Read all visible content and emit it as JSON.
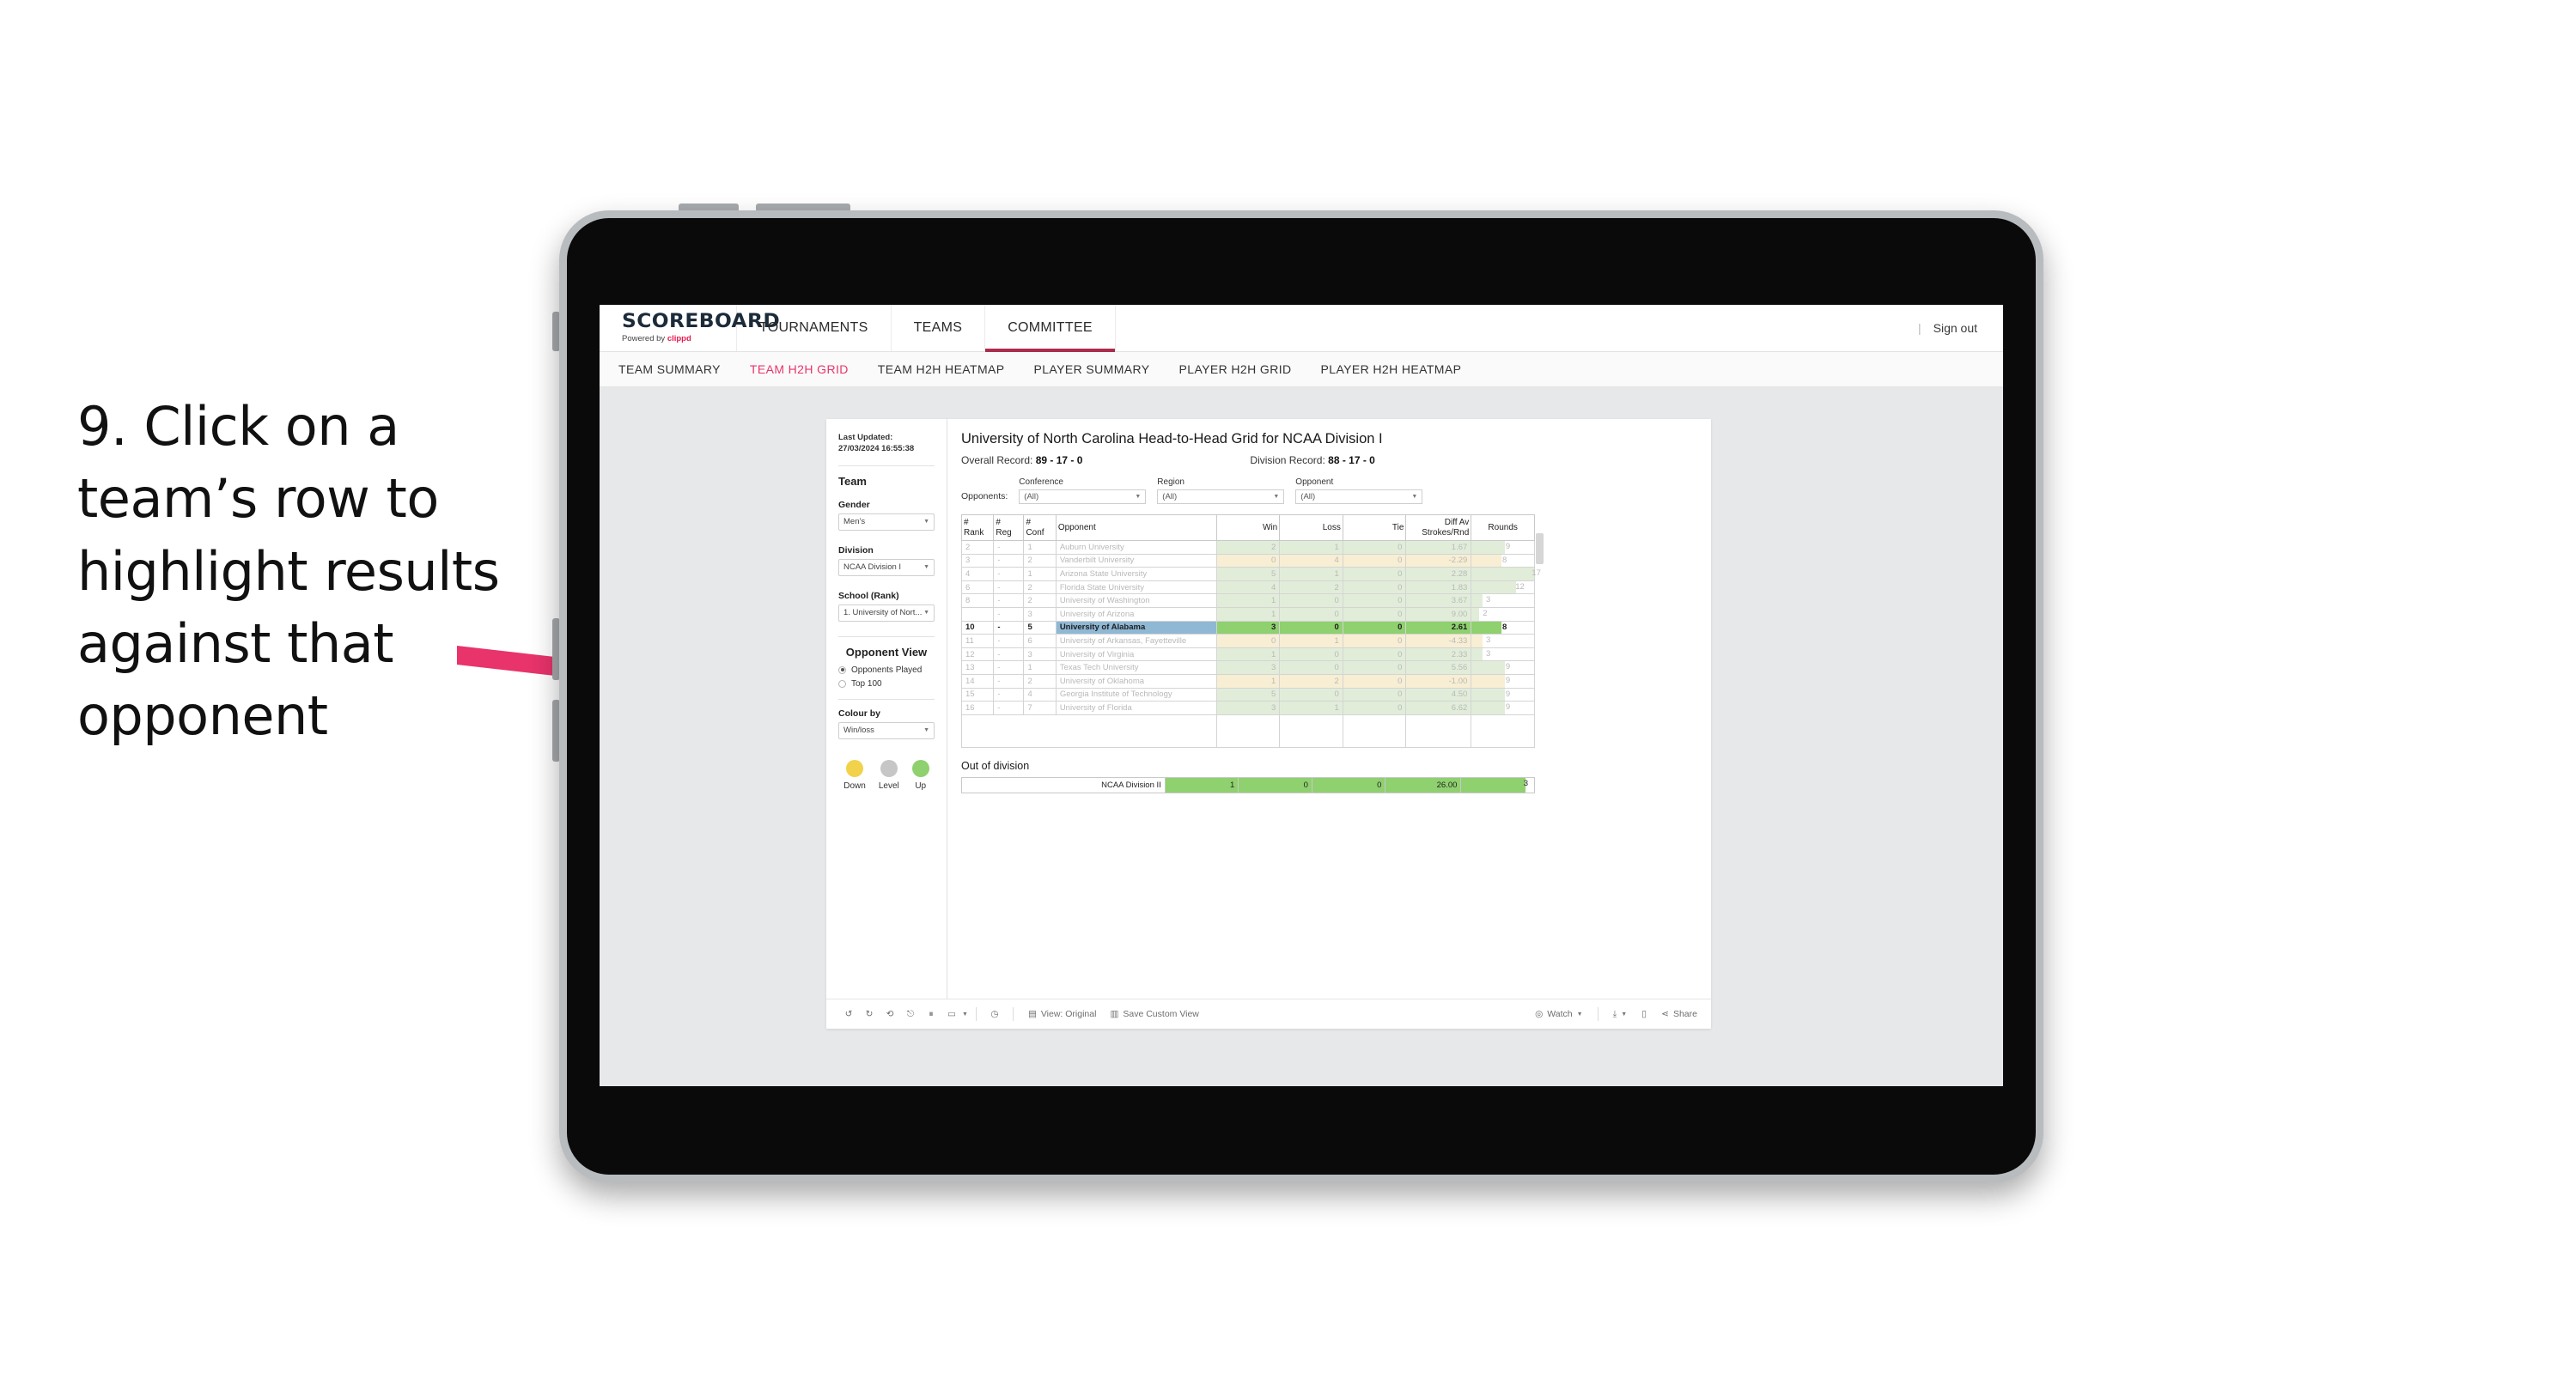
{
  "annotation": {
    "text": "9. Click on a team’s row to highlight results against that opponent",
    "arrow_color": "#E8336B"
  },
  "app": {
    "brand": {
      "title": "SCOREBOARD",
      "powered_prefix": "Powered by ",
      "powered_brand": "clippd"
    },
    "topnav": [
      {
        "label": "TOURNAMENTS",
        "active": false
      },
      {
        "label": "TEAMS",
        "active": false
      },
      {
        "label": "COMMITTEE",
        "active": true
      }
    ],
    "topbar_right": {
      "separator": "|",
      "sign_out": "Sign out"
    },
    "subnav": [
      {
        "label": "TEAM SUMMARY",
        "active": false
      },
      {
        "label": "TEAM H2H GRID",
        "active": true
      },
      {
        "label": "TEAM H2H HEATMAP",
        "active": false
      },
      {
        "label": "PLAYER SUMMARY",
        "active": false
      },
      {
        "label": "PLAYER H2H GRID",
        "active": false
      },
      {
        "label": "PLAYER H2H HEATMAP",
        "active": false
      }
    ],
    "accent_active": "#e8356b",
    "accent_underline": "#ab2c4c"
  },
  "sidebar": {
    "last_updated": "Last Updated: 27/03/2024 16:55:38",
    "team_heading": "Team",
    "fields": [
      {
        "label": "Gender",
        "value": "Men’s"
      },
      {
        "label": "Division",
        "value": "NCAA Division I"
      },
      {
        "label": "School (Rank)",
        "value": "1. University of Nort..."
      }
    ],
    "opponent_view": {
      "heading": "Opponent View",
      "options": [
        {
          "label": "Opponents Played",
          "selected": true
        },
        {
          "label": "Top 100",
          "selected": false
        }
      ]
    },
    "colour_by": {
      "label": "Colour by",
      "value": "Win/loss"
    },
    "legend": [
      {
        "label": "Down",
        "color": "#f2d14b"
      },
      {
        "label": "Level",
        "color": "#c6c6c6"
      },
      {
        "label": "Up",
        "color": "#8fd06f"
      }
    ]
  },
  "report": {
    "title": "University of North Carolina Head-to-Head Grid for NCAA Division I",
    "overall_record_label": "Overall Record:",
    "overall_record_value": "89 - 17 - 0",
    "division_record_label": "Division Record:",
    "division_record_value": "88 - 17 - 0",
    "opponents_prefix": "Opponents:",
    "filters": [
      {
        "label": "Conference",
        "value": "(All)"
      },
      {
        "label": "Region",
        "value": "(All)"
      },
      {
        "label": "Opponent",
        "value": "(All)"
      }
    ],
    "out_of_division_heading": "Out of division",
    "out_of_division_row": {
      "label": "NCAA Division II",
      "win": "1",
      "loss": "0",
      "tie": "0",
      "diff": "26.00",
      "rounds": "3",
      "rounds_pct": 88
    }
  },
  "chart_data": {
    "type": "table",
    "title": "University of North Carolina Head-to-Head Grid for NCAA Division I",
    "columns": [
      "# Rank",
      "# Reg",
      "# Conf",
      "Opponent",
      "Win",
      "Loss",
      "Tie",
      "Diff Av Strokes/Rnd",
      "Rounds"
    ],
    "max_rounds": 17,
    "rows": [
      {
        "rank": "2",
        "reg": "-",
        "conf": "1",
        "opponent": "Auburn University",
        "win": "2",
        "loss": "1",
        "tie": "0",
        "diff": "1.67",
        "rounds": "9",
        "tone": "up",
        "selected": false
      },
      {
        "rank": "3",
        "reg": "-",
        "conf": "2",
        "opponent": "Vanderbilt University",
        "win": "0",
        "loss": "4",
        "tie": "0",
        "diff": "-2.29",
        "rounds": "8",
        "tone": "down",
        "selected": false
      },
      {
        "rank": "4",
        "reg": "-",
        "conf": "1",
        "opponent": "Arizona State University",
        "win": "5",
        "loss": "1",
        "tie": "0",
        "diff": "2.28",
        "rounds": "17",
        "tone": "up",
        "selected": false
      },
      {
        "rank": "6",
        "reg": "-",
        "conf": "2",
        "opponent": "Florida State University",
        "win": "4",
        "loss": "2",
        "tie": "0",
        "diff": "1.83",
        "rounds": "12",
        "tone": "up",
        "selected": false
      },
      {
        "rank": "8",
        "reg": "-",
        "conf": "2",
        "opponent": "University of Washington",
        "win": "1",
        "loss": "0",
        "tie": "0",
        "diff": "3.67",
        "rounds": "3",
        "tone": "up",
        "selected": false
      },
      {
        "rank": "",
        "reg": "-",
        "conf": "3",
        "opponent": "University of Arizona",
        "win": "1",
        "loss": "0",
        "tie": "0",
        "diff": "9.00",
        "rounds": "2",
        "tone": "up",
        "selected": false
      },
      {
        "rank": "10",
        "reg": "-",
        "conf": "5",
        "opponent": "University of Alabama",
        "win": "3",
        "loss": "0",
        "tie": "0",
        "diff": "2.61",
        "rounds": "8",
        "tone": "up",
        "selected": true
      },
      {
        "rank": "11",
        "reg": "-",
        "conf": "6",
        "opponent": "University of Arkansas, Fayetteville",
        "win": "0",
        "loss": "1",
        "tie": "0",
        "diff": "-4.33",
        "rounds": "3",
        "tone": "down",
        "selected": false
      },
      {
        "rank": "12",
        "reg": "-",
        "conf": "3",
        "opponent": "University of Virginia",
        "win": "1",
        "loss": "0",
        "tie": "0",
        "diff": "2.33",
        "rounds": "3",
        "tone": "up",
        "selected": false
      },
      {
        "rank": "13",
        "reg": "-",
        "conf": "1",
        "opponent": "Texas Tech University",
        "win": "3",
        "loss": "0",
        "tie": "0",
        "diff": "5.56",
        "rounds": "9",
        "tone": "up",
        "selected": false
      },
      {
        "rank": "14",
        "reg": "-",
        "conf": "2",
        "opponent": "University of Oklahoma",
        "win": "1",
        "loss": "2",
        "tie": "0",
        "diff": "-1.00",
        "rounds": "9",
        "tone": "down",
        "selected": false
      },
      {
        "rank": "15",
        "reg": "-",
        "conf": "4",
        "opponent": "Georgia Institute of Technology",
        "win": "5",
        "loss": "0",
        "tie": "0",
        "diff": "4.50",
        "rounds": "9",
        "tone": "up",
        "selected": false
      },
      {
        "rank": "16",
        "reg": "-",
        "conf": "7",
        "opponent": "University of Florida",
        "win": "3",
        "loss": "1",
        "tie": "0",
        "diff": "6.62",
        "rounds": "9",
        "tone": "up",
        "selected": false
      }
    ],
    "colors": {
      "up": "#e1edd9",
      "down": "#f7eed3",
      "selected_bar": "#8fd06f",
      "selected_label": "#8fb8d4"
    }
  },
  "toolbar": {
    "view_original": "View: Original",
    "save_custom_view": "Save Custom View",
    "watch": "Watch",
    "share": "Share"
  }
}
